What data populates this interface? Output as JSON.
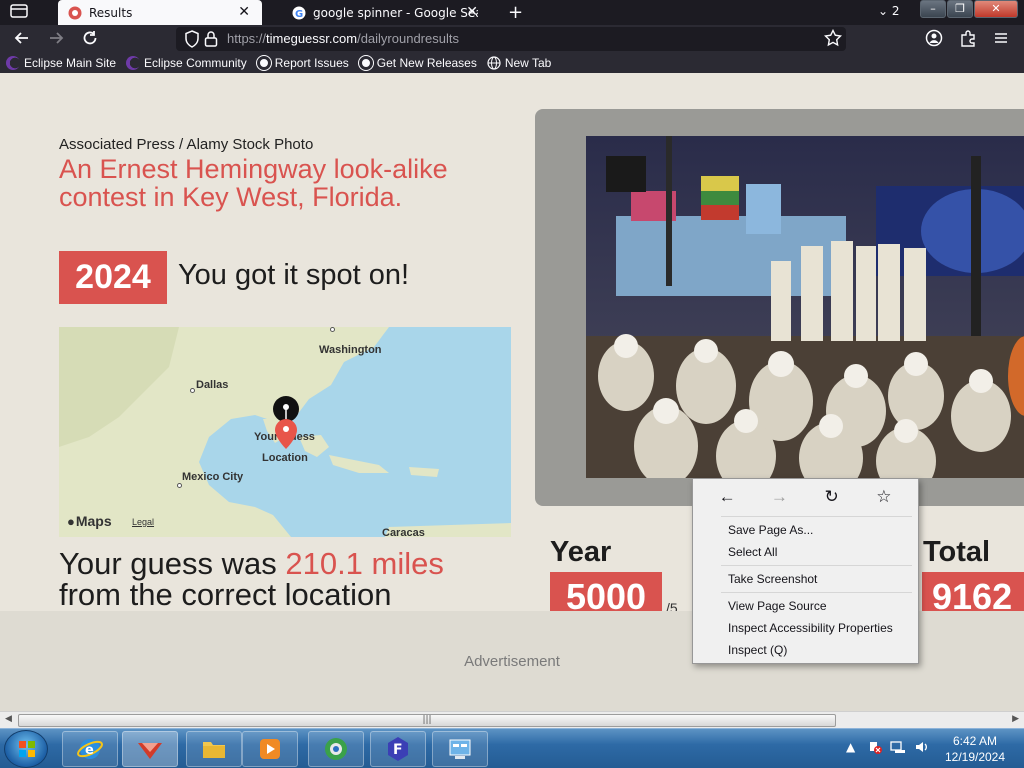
{
  "tabs": [
    {
      "label": "Results",
      "active": true
    },
    {
      "label": "google spinner - Google Sea",
      "active": false
    }
  ],
  "tab_count": "2",
  "address_bar": {
    "prefix": "https://",
    "domain": "timeguessr.com",
    "path": "/dailyroundresults"
  },
  "bookmarks": [
    {
      "label": "Eclipse Main Site",
      "icon": "eclipse-icon"
    },
    {
      "label": "Eclipse Community",
      "icon": "eclipse-icon"
    },
    {
      "label": "Report Issues",
      "icon": "github-icon"
    },
    {
      "label": "Get New Releases",
      "icon": "github-icon"
    },
    {
      "label": "New Tab",
      "icon": "globe-icon"
    }
  ],
  "result": {
    "credit": "Associated Press / Alamy Stock Photo",
    "headline": "An Ernest Hemingway look-alike contest in Key West, Florida.",
    "year": "2024",
    "year_verdict": "You got it spot on!",
    "distance_prefix": "Your guess was",
    "distance_value": "210.1 miles",
    "distance_suffix": "from the correct location"
  },
  "map": {
    "labels": {
      "washington": "Washington",
      "dallas": "Dallas",
      "mexico_city": "Mexico City",
      "caracas": "Caracas",
      "your_guess": "Your Guess",
      "location": "Location"
    },
    "attribution": "Maps",
    "legal": "Legal"
  },
  "scores": {
    "year_label": "Year",
    "year_score": "5000",
    "year_outof": "/5",
    "total_label": "Total",
    "total_score": "9162"
  },
  "advertisement": "Advertisement",
  "context_menu": {
    "items": [
      {
        "label": "Save Page As..."
      },
      {
        "label": "Select All"
      },
      {
        "label": "Take Screenshot"
      },
      {
        "label": "View Page Source"
      },
      {
        "label": "Inspect Accessibility Properties"
      },
      {
        "label": "Inspect (Q)"
      }
    ]
  },
  "taskbar": {
    "time": "6:42 AM",
    "date": "12/19/2024"
  },
  "colors": {
    "accent": "#d9534f",
    "page_bg": "#e9e5dc",
    "chrome_dark": "#1c1b22"
  }
}
